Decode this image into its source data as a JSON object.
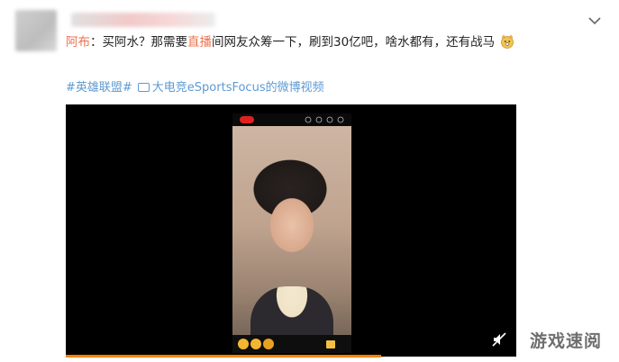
{
  "post": {
    "author_link": "阿布",
    "text_before": "：买阿水？那需要",
    "live_link": "直播",
    "text_after": "间网友众筹一下，刷到30亿吧，啥水都有，还有战马",
    "emoji": "doge-emoji"
  },
  "topic": {
    "hashtag": "#英雄联盟#",
    "video_source": "大电竞eSportsFocus的微博视频"
  },
  "video": {
    "progress": 0.7,
    "progress_color": "#ff8200"
  },
  "watermark": "游戏速阅",
  "colors": {
    "link_orange": "#eb7350",
    "topic_blue": "#5d9ad3"
  }
}
